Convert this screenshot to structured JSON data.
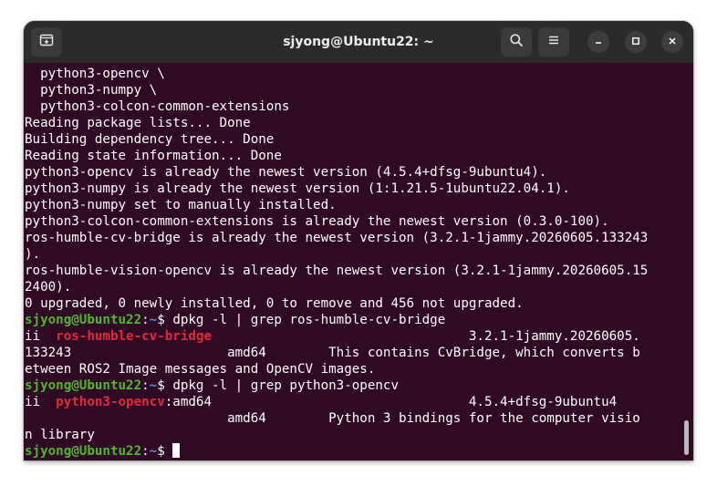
{
  "window": {
    "title": "sjyong@Ubuntu22: ~"
  },
  "icons": {
    "new_tab": "new-tab-icon",
    "search": "search-icon",
    "menu": "hamburger-menu-icon",
    "minimize": "minimize-icon",
    "maximize": "maximize-icon",
    "close": "close-icon"
  },
  "colors": {
    "terminal_bg": "#300a24",
    "titlebar_bg": "#2b2b2b",
    "prompt_user": "#4eb82a",
    "prompt_path": "#5d8fd6",
    "grep_match": "#e0293a"
  },
  "terminal": {
    "prompt": {
      "user": "sjyong@Ubuntu22",
      "sep": ":",
      "path": "~",
      "symbol": "$ "
    },
    "lines": [
      {
        "text": "  python3-opencv \\"
      },
      {
        "text": "  python3-numpy \\"
      },
      {
        "text": "  python3-colcon-common-extensions"
      },
      {
        "text": "Reading package lists... Done"
      },
      {
        "text": "Building dependency tree... Done"
      },
      {
        "text": "Reading state information... Done"
      },
      {
        "text": "python3-opencv is already the newest version (4.5.4+dfsg-9ubuntu4)."
      },
      {
        "text": "python3-numpy is already the newest version (1:1.21.5-1ubuntu22.04.1)."
      },
      {
        "text": "python3-numpy set to manually installed."
      },
      {
        "text": "python3-colcon-common-extensions is already the newest version (0.3.0-100)."
      },
      {
        "text": "ros-humble-cv-bridge is already the newest version (3.2.1-1jammy.20260605.133243"
      },
      {
        "text": ")."
      },
      {
        "text": "ros-humble-vision-opencv is already the newest version (3.2.1-1jammy.20260605.15"
      },
      {
        "text": "2400)."
      },
      {
        "text": "0 upgraded, 0 newly installed, 0 to remove and 456 not upgraded."
      },
      {
        "prompt": true,
        "text": "dpkg -l | grep ros-humble-cv-bridge"
      },
      {
        "pre": "ii  ",
        "match": "ros-humble-cv-bridge",
        "post": "                                 3.2.1-1jammy.20260605."
      },
      {
        "text": "133243                    amd64        This contains CvBridge, which converts b"
      },
      {
        "text": "etween ROS2 Image messages and OpenCV images."
      },
      {
        "prompt": true,
        "text": "dpkg -l | grep python3-opencv"
      },
      {
        "pre": "ii  ",
        "match": "python3-opencv",
        "post": ":amd64                                 4.5.4+dfsg-9ubuntu4"
      },
      {
        "text": "                          amd64        Python 3 bindings for the computer visio"
      },
      {
        "text": "n library"
      },
      {
        "prompt": true,
        "text": "",
        "cursor": true
      }
    ]
  }
}
